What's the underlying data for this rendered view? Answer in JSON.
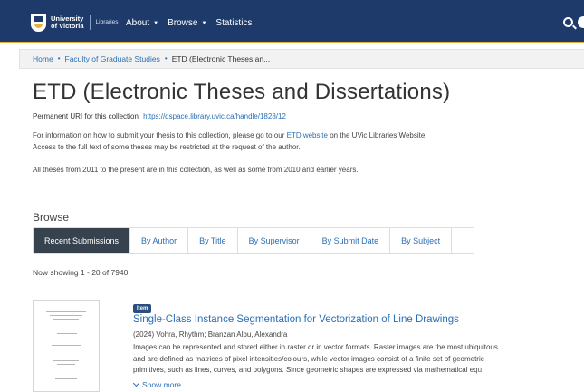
{
  "header": {
    "logo_line1": "University",
    "logo_line2": "of Victoria",
    "logo_sub": "Libraries",
    "nav": [
      {
        "label": "About",
        "has_dropdown": true
      },
      {
        "label": "Browse",
        "has_dropdown": true
      },
      {
        "label": "Statistics",
        "has_dropdown": false
      }
    ]
  },
  "breadcrumb": {
    "home": "Home",
    "parent": "Faculty of Graduate Studies",
    "current": "ETD (Electronic Theses an..."
  },
  "collection": {
    "title": "ETD (Electronic Theses and Dissertations)",
    "uri_label": "Permanent URI for this collection",
    "uri": "https://dspace.library.uvic.ca/handle/1828/12",
    "info_prefix": "For information on how to submit your thesis to this collection, please go to our",
    "info_link": "ETD website",
    "info_suffix": "on the UVic Libraries Website.",
    "access_note": "Access to the full text of some theses may be restricted at the request of the author.",
    "scope_note": "All theses from 2011 to the present are in this collection, as well as some from 2010 and earlier years."
  },
  "browse": {
    "heading": "Browse",
    "tabs": [
      {
        "label": "Recent Submissions",
        "active": true
      },
      {
        "label": "By Author",
        "active": false
      },
      {
        "label": "By Title",
        "active": false
      },
      {
        "label": "By Supervisor",
        "active": false
      },
      {
        "label": "By Submit Date",
        "active": false
      },
      {
        "label": "By Subject",
        "active": false
      }
    ],
    "showing": "Now showing 1 - 20 of 7940"
  },
  "items": [
    {
      "badge": "Item",
      "title": "Single-Class Instance Segmentation for Vectorization of Line Drawings",
      "meta": "(2024) Vohra, Rhythm; Branzan Albu, Alexandra",
      "abstract_lines": [
        "Images can be represented and stored either in raster or in vector formats. Raster images are the most ubiquitous",
        "and are defined as matrices of pixel intensities/colours, while vector images consist of a finite set of geometric",
        "primitives, such as lines, curves, and polygons. Since geometric shapes are expressed via mathematical equ"
      ],
      "show_more": "Show more"
    }
  ],
  "colors": {
    "header_bg": "#1e3a6a",
    "accent_gold": "#e6b23c",
    "link": "#2b6fb5",
    "active_tab": "#37424f"
  },
  "icons": {
    "search": "search-icon",
    "user": "user-icon",
    "logo": "shield-icon"
  }
}
